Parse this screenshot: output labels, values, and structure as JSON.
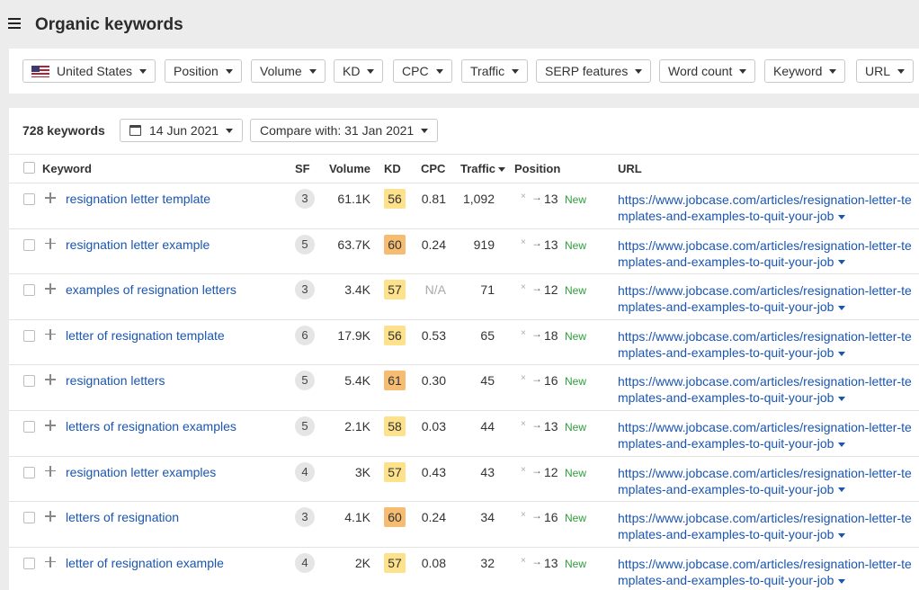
{
  "header": {
    "title": "Organic keywords"
  },
  "filters": {
    "country": "United States",
    "position": "Position",
    "volume": "Volume",
    "kd": "KD",
    "cpc": "CPC",
    "traffic": "Traffic",
    "serp": "SERP features",
    "word_count": "Word count",
    "keyword": "Keyword",
    "url": "URL"
  },
  "toolbar": {
    "count": "728 keywords",
    "date": "14 Jun 2021",
    "compare": "Compare with: 31 Jan 2021"
  },
  "table": {
    "columns": {
      "keyword": "Keyword",
      "sf": "SF",
      "volume": "Volume",
      "kd": "KD",
      "cpc": "CPC",
      "traffic": "Traffic",
      "position": "Position",
      "url": "URL"
    },
    "rows": [
      {
        "keyword": "resignation letter template",
        "sf": "3",
        "volume": "61.1K",
        "kd": "56",
        "kd_color": "#fde18b",
        "cpc": "0.81",
        "traffic": "1,092",
        "x": "×",
        "arrow": "→",
        "position": "13",
        "status": "New",
        "url": "https://www.jobcase.com/articles/resignation-letter-templates-and-examples-to-quit-your-job"
      },
      {
        "keyword": "resignation letter example",
        "sf": "5",
        "volume": "63.7K",
        "kd": "60",
        "kd_color": "#f6bd72",
        "cpc": "0.24",
        "traffic": "919",
        "x": "×",
        "arrow": "→",
        "position": "13",
        "status": "New",
        "url": "https://www.jobcase.com/articles/resignation-letter-templates-and-examples-to-quit-your-job"
      },
      {
        "keyword": "examples of resignation letters",
        "sf": "3",
        "volume": "3.4K",
        "kd": "57",
        "kd_color": "#fde18b",
        "cpc": "N/A",
        "traffic": "71",
        "x": "×",
        "arrow": "→",
        "position": "12",
        "status": "New",
        "url": "https://www.jobcase.com/articles/resignation-letter-templates-and-examples-to-quit-your-job"
      },
      {
        "keyword": "letter of resignation template",
        "sf": "6",
        "volume": "17.9K",
        "kd": "56",
        "kd_color": "#fde18b",
        "cpc": "0.53",
        "traffic": "65",
        "x": "×",
        "arrow": "→",
        "position": "18",
        "status": "New",
        "url": "https://www.jobcase.com/articles/resignation-letter-templates-and-examples-to-quit-your-job"
      },
      {
        "keyword": "resignation letters",
        "sf": "5",
        "volume": "5.4K",
        "kd": "61",
        "kd_color": "#f6bd72",
        "cpc": "0.30",
        "traffic": "45",
        "x": "×",
        "arrow": "→",
        "position": "16",
        "status": "New",
        "url": "https://www.jobcase.com/articles/resignation-letter-templates-and-examples-to-quit-your-job"
      },
      {
        "keyword": "letters of resignation examples",
        "sf": "5",
        "volume": "2.1K",
        "kd": "58",
        "kd_color": "#fde18b",
        "cpc": "0.03",
        "traffic": "44",
        "x": "×",
        "arrow": "→",
        "position": "13",
        "status": "New",
        "url": "https://www.jobcase.com/articles/resignation-letter-templates-and-examples-to-quit-your-job"
      },
      {
        "keyword": "resignation letter examples",
        "sf": "4",
        "volume": "3K",
        "kd": "57",
        "kd_color": "#fde18b",
        "cpc": "0.43",
        "traffic": "43",
        "x": "×",
        "arrow": "→",
        "position": "12",
        "status": "New",
        "url": "https://www.jobcase.com/articles/resignation-letter-templates-and-examples-to-quit-your-job"
      },
      {
        "keyword": "letters of resignation",
        "sf": "3",
        "volume": "4.1K",
        "kd": "60",
        "kd_color": "#f6bd72",
        "cpc": "0.24",
        "traffic": "34",
        "x": "×",
        "arrow": "→",
        "position": "16",
        "status": "New",
        "url": "https://www.jobcase.com/articles/resignation-letter-templates-and-examples-to-quit-your-job"
      },
      {
        "keyword": "letter of resignation example",
        "sf": "4",
        "volume": "2K",
        "kd": "57",
        "kd_color": "#fde18b",
        "cpc": "0.08",
        "traffic": "32",
        "x": "×",
        "arrow": "→",
        "position": "13",
        "status": "New",
        "url": "https://www.jobcase.com/articles/resignation-letter-templates-and-examples-to-quit-your-job"
      }
    ]
  }
}
